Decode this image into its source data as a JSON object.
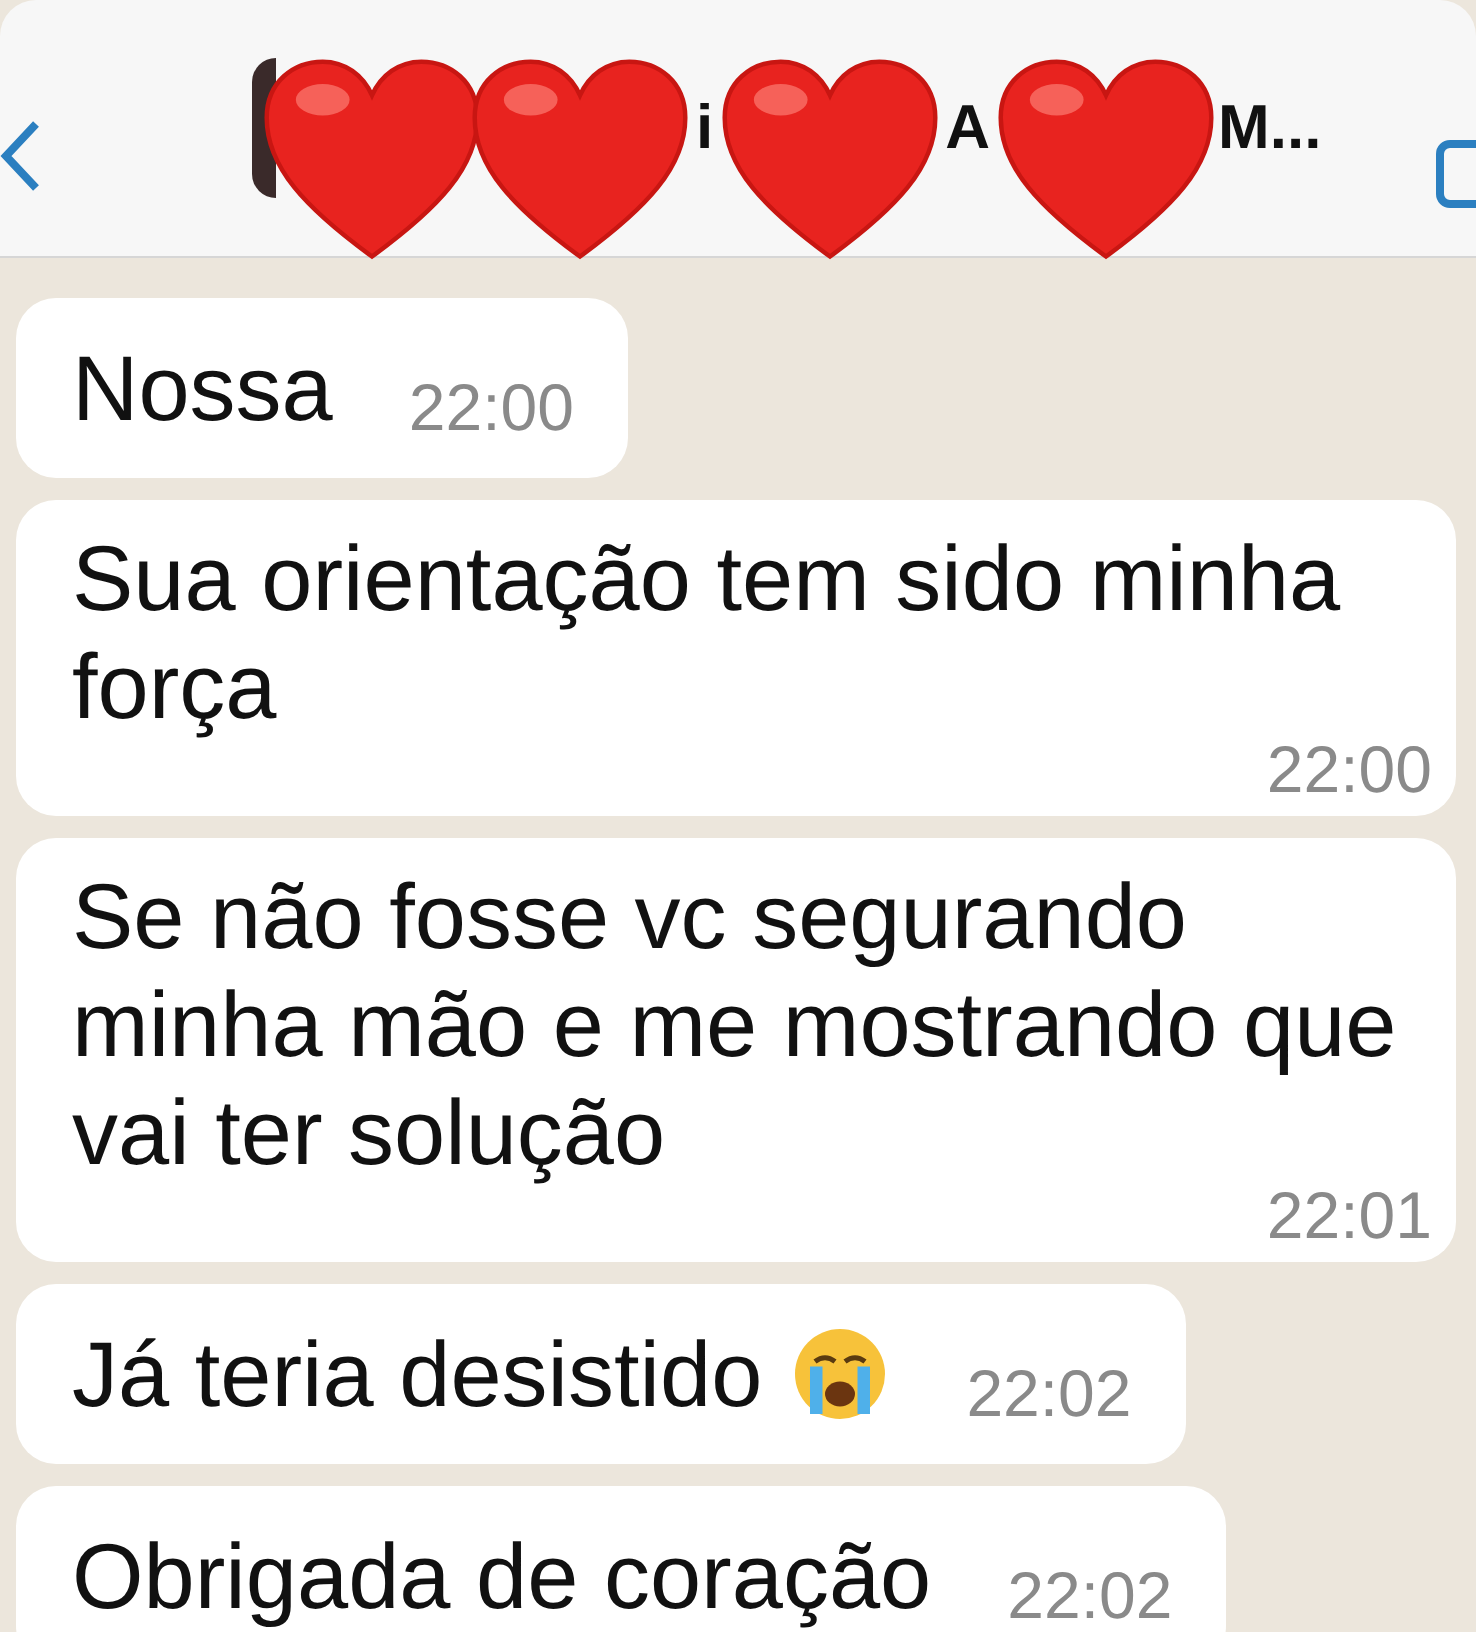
{
  "header": {
    "title_fragments": [
      "i",
      "A",
      "M..."
    ]
  },
  "messages": [
    {
      "text": "Nossa",
      "time": "22:00",
      "kind": "inline",
      "crying_emoji": false
    },
    {
      "text": "Sua orientação tem sido minha força",
      "time": "22:00",
      "kind": "block",
      "crying_emoji": false
    },
    {
      "text": "Se não fosse vc segurando minha mão e me mostrando que vai ter solução",
      "time": "22:01",
      "kind": "block",
      "crying_emoji": false
    },
    {
      "text": "Já teria desistido",
      "time": "22:02",
      "kind": "inline",
      "crying_emoji": true
    },
    {
      "text": "Obrigada de coração",
      "time": "22:02",
      "kind": "inline",
      "crying_emoji": false
    }
  ]
}
